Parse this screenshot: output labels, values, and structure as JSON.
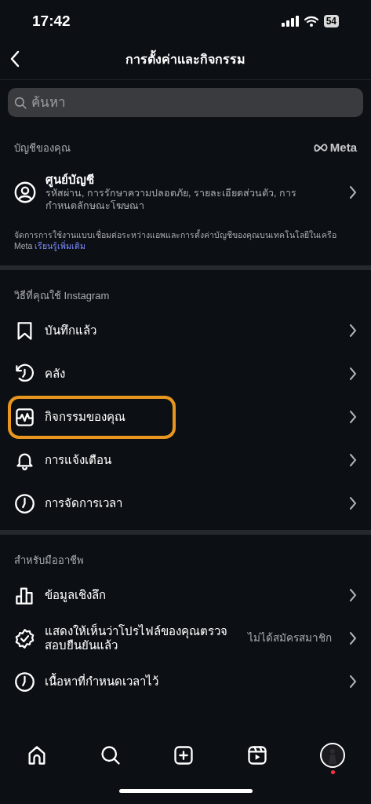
{
  "status_bar": {
    "time": "17:42",
    "battery": "54"
  },
  "header": {
    "title": "การตั้งค่าและกิจกรรม"
  },
  "search": {
    "placeholder": "ค้นหา"
  },
  "account_section": {
    "title": "บัญชีของคุณ",
    "brand": "Meta",
    "item": {
      "label": "ศูนย์บัญชี",
      "description": "รหัสผ่าน, การรักษาความปลอดภัย, รายละเอียดส่วนตัว, การกำหนดลักษณะโฆษณา"
    },
    "note": "จัดการการใช้งานแบบเชื่อมต่อระหว่างแอพและการตั้งค่าบัญชีของคุณบนเทคโนโลยีในเครือ Meta",
    "note_link": "เรียนรู้เพิ่มเติม"
  },
  "sections": [
    {
      "title": "วิธีที่คุณใช้ Instagram",
      "items": [
        {
          "kind": "bookmark",
          "label": "บันทึกแล้ว",
          "highlighted": false
        },
        {
          "kind": "archive",
          "label": "คลัง",
          "highlighted": false
        },
        {
          "kind": "activity",
          "label": "กิจกรรมของคุณ",
          "highlighted": true
        },
        {
          "kind": "bell",
          "label": "การแจ้งเตือน",
          "highlighted": false
        },
        {
          "kind": "clock",
          "label": "การจัดการเวลา",
          "highlighted": false
        }
      ]
    },
    {
      "title": "สำหรับมืออาชีพ",
      "items": [
        {
          "kind": "chart",
          "label": "ข้อมูลเชิงลึก",
          "highlighted": false
        },
        {
          "kind": "verified",
          "label": "แสดงให้เห็นว่าโปรไฟล์ของคุณตรวจสอบยืนยันแล้ว",
          "value": "ไม่ได้สมัครสมาชิก",
          "highlighted": false
        },
        {
          "kind": "clock",
          "label": "เนื้อหาที่กำหนดเวลาไว้",
          "highlighted": false
        }
      ]
    }
  ],
  "tab_bar": {
    "items": [
      {
        "kind": "home"
      },
      {
        "kind": "search"
      },
      {
        "kind": "create"
      },
      {
        "kind": "reels"
      },
      {
        "kind": "profile",
        "notification": true
      }
    ]
  }
}
